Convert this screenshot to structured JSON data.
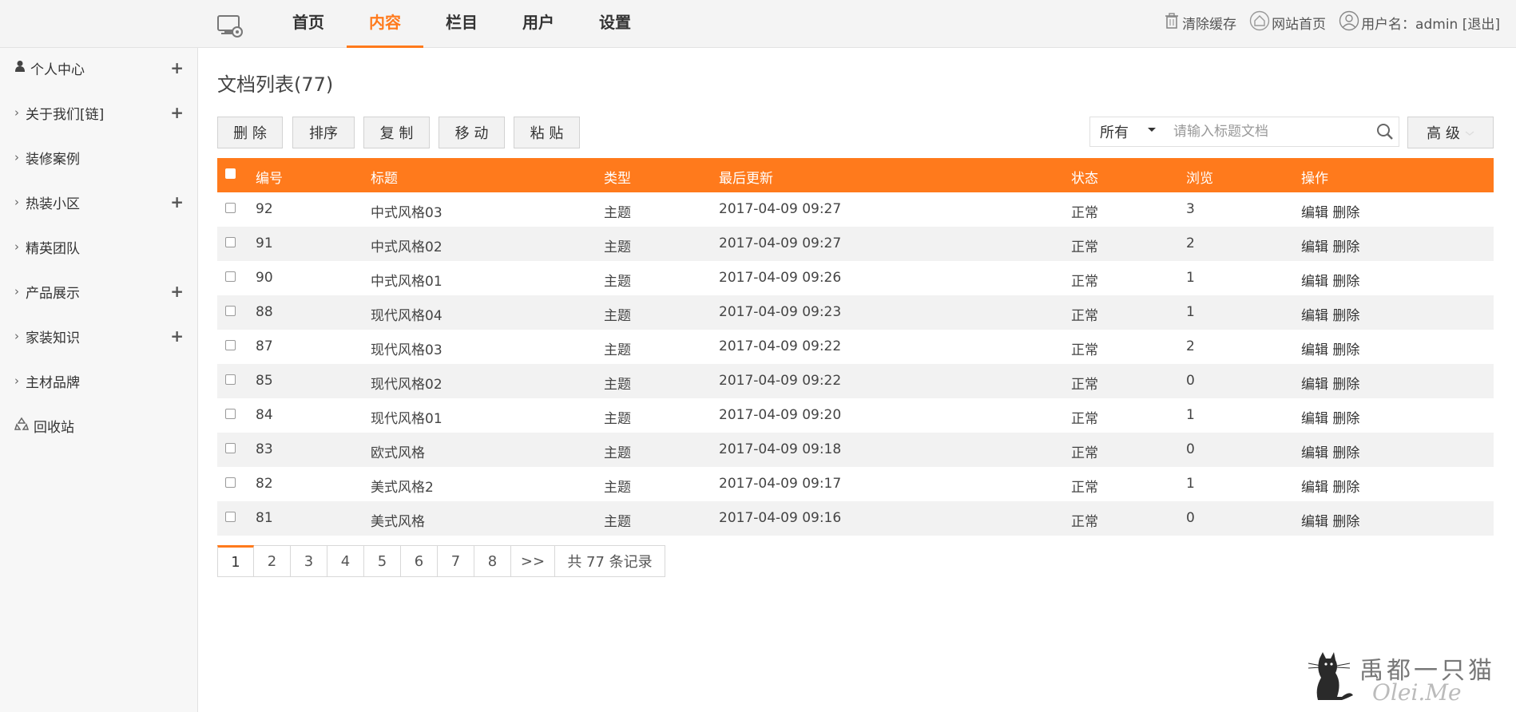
{
  "nav": {
    "items": [
      {
        "label": "首页",
        "active": false
      },
      {
        "label": "内容",
        "active": true
      },
      {
        "label": "栏目",
        "active": false
      },
      {
        "label": "用户",
        "active": false
      },
      {
        "label": "设置",
        "active": false
      }
    ]
  },
  "top_right": {
    "clear_cache": "清除缓存",
    "site_home": "网站首页",
    "user": "用户名：admin [退出]"
  },
  "sidebar": {
    "items": [
      {
        "label": "个人中心",
        "icon": "user-icon",
        "plus": true
      },
      {
        "label": "关于我们[链]",
        "icon": "chevron-right-icon",
        "plus": true
      },
      {
        "label": "装修案例",
        "icon": "chevron-right-icon",
        "plus": false
      },
      {
        "label": "热装小区",
        "icon": "chevron-right-icon",
        "plus": true
      },
      {
        "label": "精英团队",
        "icon": "chevron-right-icon",
        "plus": false
      },
      {
        "label": "产品展示",
        "icon": "chevron-right-icon",
        "plus": true
      },
      {
        "label": "家装知识",
        "icon": "chevron-right-icon",
        "plus": true
      },
      {
        "label": "主材品牌",
        "icon": "chevron-right-icon",
        "plus": false
      },
      {
        "label": "回收站",
        "icon": "recycle-icon",
        "plus": false
      }
    ]
  },
  "main": {
    "title": "文档列表(77)",
    "buttons": {
      "delete": "删 除",
      "sort": "排序",
      "copy": "复 制",
      "move": "移 动",
      "paste": "粘 贴",
      "advanced": "高 级"
    },
    "search": {
      "filter_value": "所有",
      "placeholder": "请输入标题文档"
    }
  },
  "table": {
    "headers": {
      "id": "编号",
      "title": "标题",
      "type": "类型",
      "updated": "最后更新",
      "status": "状态",
      "views": "浏览",
      "ops": "操作"
    },
    "rows": [
      {
        "id": "92",
        "title": "中式风格03",
        "type": "主题",
        "updated": "2017-04-09 09:27",
        "status": "正常",
        "views": "3",
        "ops": "编辑 删除"
      },
      {
        "id": "91",
        "title": "中式风格02",
        "type": "主题",
        "updated": "2017-04-09 09:27",
        "status": "正常",
        "views": "2",
        "ops": "编辑 删除"
      },
      {
        "id": "90",
        "title": "中式风格01",
        "type": "主题",
        "updated": "2017-04-09 09:26",
        "status": "正常",
        "views": "1",
        "ops": "编辑 删除"
      },
      {
        "id": "88",
        "title": "现代风格04",
        "type": "主题",
        "updated": "2017-04-09 09:23",
        "status": "正常",
        "views": "1",
        "ops": "编辑 删除"
      },
      {
        "id": "87",
        "title": "现代风格03",
        "type": "主题",
        "updated": "2017-04-09 09:22",
        "status": "正常",
        "views": "2",
        "ops": "编辑 删除"
      },
      {
        "id": "85",
        "title": "现代风格02",
        "type": "主题",
        "updated": "2017-04-09 09:22",
        "status": "正常",
        "views": "0",
        "ops": "编辑 删除"
      },
      {
        "id": "84",
        "title": "现代风格01",
        "type": "主题",
        "updated": "2017-04-09 09:20",
        "status": "正常",
        "views": "1",
        "ops": "编辑 删除"
      },
      {
        "id": "83",
        "title": "欧式风格",
        "type": "主题",
        "updated": "2017-04-09 09:18",
        "status": "正常",
        "views": "0",
        "ops": "编辑 删除"
      },
      {
        "id": "82",
        "title": "美式风格2",
        "type": "主题",
        "updated": "2017-04-09 09:17",
        "status": "正常",
        "views": "1",
        "ops": "编辑 删除"
      },
      {
        "id": "81",
        "title": "美式风格",
        "type": "主题",
        "updated": "2017-04-09 09:16",
        "status": "正常",
        "views": "0",
        "ops": "编辑 删除"
      }
    ]
  },
  "pager": {
    "pages": [
      "1",
      "2",
      "3",
      "4",
      "5",
      "6",
      "7",
      "8",
      ">>"
    ],
    "total": "共 77 条记录"
  },
  "watermark": {
    "text": "禹都一只猫",
    "sub": "Olei.Me"
  },
  "colors": {
    "accent": "#ff7a1c"
  }
}
